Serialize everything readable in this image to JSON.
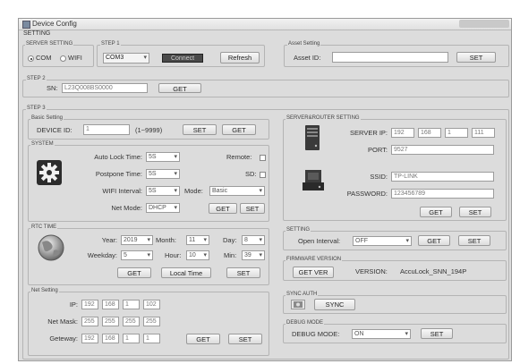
{
  "window": {
    "title": "Device Config"
  },
  "setting": {
    "label": "SETTING"
  },
  "server_setting": {
    "legend": "SERVER SETTING",
    "com": "COM",
    "wifi": "WIFI"
  },
  "step1": {
    "legend": "STEP 1",
    "port": "COM3",
    "status": "Connect",
    "refresh": "Refresh"
  },
  "asset": {
    "legend": "Asset Setting",
    "label": "Asset ID:",
    "value": "",
    "set": "SET"
  },
  "step2": {
    "legend": "STEP 2",
    "sn_label": "SN:",
    "sn_value": "L23Q008BS0000",
    "get": "GET"
  },
  "step3": {
    "legend": "STEP 3"
  },
  "basic": {
    "legend": "Basic Setting",
    "device_id_label": "DEVICE ID:",
    "device_id": "1",
    "range": "(1~9999)",
    "set": "SET",
    "get": "GET"
  },
  "system": {
    "legend": "SYSTEM",
    "auto_lock_label": "Auto Lock Time:",
    "auto_lock": "5S",
    "remote_label": "Remote:",
    "postpone_label": "Postpone Time:",
    "postpone": "5S",
    "sd_label": "SD:",
    "wifi_interval_label": "WIFI Interval:",
    "wifi_interval": "5S",
    "mode_label": "Mode:",
    "mode": "Basic",
    "net_mode_label": "Net Mode:",
    "net_mode": "DHCP",
    "get": "GET",
    "set": "SET"
  },
  "rtc": {
    "legend": "RTC TIME",
    "year_label": "Year:",
    "year": "2019",
    "month_label": "Month:",
    "month": "11",
    "day_label": "Day:",
    "day": "8",
    "weekday_label": "Weekday:",
    "weekday": "5",
    "hour_label": "Hour:",
    "hour": "10",
    "min_label": "Min:",
    "min": "39",
    "get": "GET",
    "local_time": "Local Time",
    "set": "SET"
  },
  "net": {
    "legend": "Net Setting",
    "ip_label": "IP:",
    "ip": [
      "192",
      "168",
      "1",
      "102"
    ],
    "mask_label": "Net Mask:",
    "mask": [
      "255",
      "255",
      "255",
      "255"
    ],
    "gateway_label": "Geteway:",
    "gateway": [
      "192",
      "168",
      "1",
      "1"
    ],
    "get": "GET",
    "set": "SET"
  },
  "server_router": {
    "legend": "SERVER&ROUTER SETTING",
    "server_ip_label": "SERVER IP:",
    "server_ip": [
      "192",
      "168",
      "1",
      "111"
    ],
    "port_label": "PORT:",
    "port": "9527",
    "ssid_label": "SSID:",
    "ssid": "TP-LINK",
    "password_label": "PASSWORD:",
    "password": "123456789",
    "get": "GET",
    "set": "SET"
  },
  "open_setting": {
    "legend": "SETTING",
    "label": "Open Interval:",
    "value": "OFF",
    "get": "GET",
    "set": "SET"
  },
  "firmware": {
    "legend": "FIRMWARE VERSION",
    "get_ver": "GET VER",
    "version_label": "VERSION:",
    "version": "AccuLock_SNN_194P"
  },
  "sync": {
    "legend": "SYNC AUTH",
    "sync": "SYNC"
  },
  "debug": {
    "legend": "DEBUG MODE",
    "label": "DEBUG MODE:",
    "value": "ON",
    "set": "SET"
  },
  "icons": {
    "system": "gear-icon",
    "rtc": "globe-icon",
    "server": "server-icon",
    "router": "router-icon",
    "sync": "camera-icon",
    "window": "app-icon"
  }
}
